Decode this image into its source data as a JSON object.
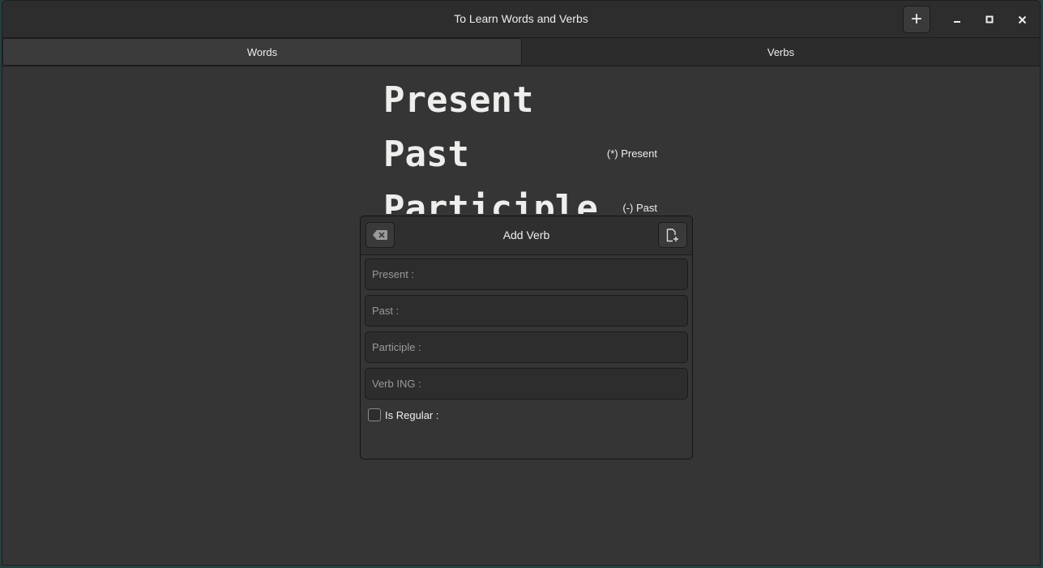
{
  "window": {
    "title": "To Learn Words and Verbs"
  },
  "header": {
    "add_button_glyph": "+",
    "minimize_glyph": "–",
    "maximize_glyph": "□",
    "close_glyph": "✕"
  },
  "tabs": [
    {
      "label": "Words",
      "active": true
    },
    {
      "label": "Verbs",
      "active": false
    }
  ],
  "flashcard": {
    "present": "Present",
    "past": "Past",
    "participle": "Participle",
    "note_present": "(*) Present",
    "note_past": "(-) Past"
  },
  "dialog": {
    "title": "Add Verb",
    "clear_icon": "edit-clear-icon",
    "save_icon": "document-new-icon",
    "fields": {
      "present_placeholder": "Present :",
      "past_placeholder": "Past :",
      "participle_placeholder": "Participle :",
      "verb_ing_placeholder": "Verb ING :"
    },
    "regular_label": "Is Regular :",
    "regular_checked": false
  },
  "colors": {
    "window_bg": "#353535",
    "headerbar_bg": "#2d2d2d",
    "text": "#eeeeec",
    "desktop": "#24403f"
  }
}
